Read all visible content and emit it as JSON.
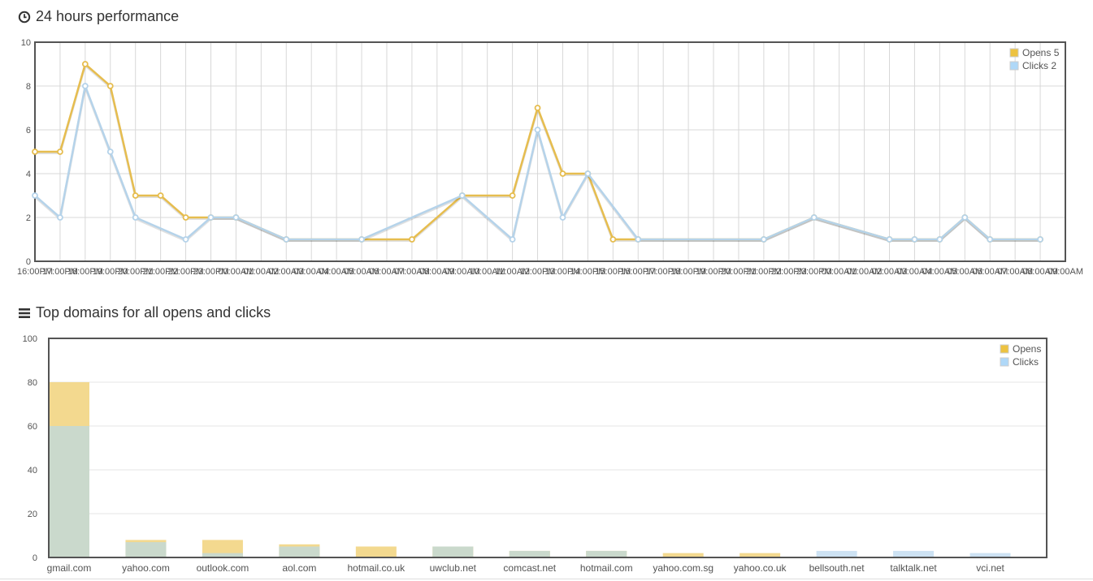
{
  "section1": {
    "title": "24 hours performance",
    "icon": "clock-icon"
  },
  "section2": {
    "title": "Top domains for all opens and clicks",
    "icon": "list-icon"
  },
  "colors": {
    "opens": "#e6bd4f",
    "opens_fill": "#f3d98f",
    "opens_legend": "#edc240",
    "clicks": "#b5d3ea",
    "clicks_fill": "#cde2f3",
    "clicks_legend": "#afd8f8",
    "overlap_fill": "#cad9cc",
    "grid": "#d8d8d8",
    "border": "#545454"
  },
  "chart_data": [
    {
      "type": "line",
      "ylim": [
        0,
        10
      ],
      "yticks": [
        0,
        2,
        4,
        6,
        8,
        10
      ],
      "grid": true,
      "legend_position": "top-right",
      "x_labels": [
        "16:00PM",
        "17:00PM",
        "18:00PM",
        "19:00PM",
        "20:00PM",
        "21:00PM",
        "22:00PM",
        "23:00PM",
        "00:00AM",
        "01:00AM",
        "02:00AM",
        "03:00AM",
        "04:00AM",
        "05:00AM",
        "06:00AM",
        "07:00AM",
        "08:00AM",
        "09:00AM",
        "10:00AM",
        "11:00AM",
        "12:00PM",
        "13:00PM",
        "14:00PM",
        "15:00PM",
        "16:00PM",
        "17:00PM",
        "18:00PM",
        "19:00PM",
        "20:00PM",
        "21:00PM",
        "22:00PM",
        "23:00PM",
        "00:00AM",
        "01:00AM",
        "02:00AM",
        "03:00AM",
        "04:00AM",
        "05:00AM",
        "06:00AM",
        "07:00AM",
        "08:00AM",
        "09:00AM"
      ],
      "series": [
        {
          "name": "Opens 5",
          "points": [
            [
              0,
              5
            ],
            [
              1,
              5
            ],
            [
              2,
              9
            ],
            [
              3,
              8
            ],
            [
              4,
              3
            ],
            [
              5,
              3
            ],
            [
              6,
              2
            ],
            [
              7,
              2
            ],
            [
              8,
              2
            ],
            [
              10,
              1
            ],
            [
              13,
              1
            ],
            [
              15,
              1
            ],
            [
              17,
              3
            ],
            [
              19,
              3
            ],
            [
              20,
              7
            ],
            [
              21,
              4
            ],
            [
              22,
              4
            ],
            [
              23,
              1
            ],
            [
              24,
              1
            ],
            [
              29,
              1
            ],
            [
              31,
              2
            ],
            [
              34,
              1
            ],
            [
              35,
              1
            ],
            [
              36,
              1
            ],
            [
              37,
              2
            ],
            [
              38,
              1
            ],
            [
              40,
              1
            ]
          ]
        },
        {
          "name": "Clicks 2",
          "points": [
            [
              0,
              3
            ],
            [
              1,
              2
            ],
            [
              2,
              8
            ],
            [
              3,
              5
            ],
            [
              4,
              2
            ],
            [
              6,
              1
            ],
            [
              7,
              2
            ],
            [
              8,
              2
            ],
            [
              10,
              1
            ],
            [
              13,
              1
            ],
            [
              17,
              3
            ],
            [
              19,
              1
            ],
            [
              20,
              6
            ],
            [
              21,
              2
            ],
            [
              22,
              4
            ],
            [
              24,
              1
            ],
            [
              29,
              1
            ],
            [
              31,
              2
            ],
            [
              34,
              1
            ],
            [
              35,
              1
            ],
            [
              36,
              1
            ],
            [
              37,
              2
            ],
            [
              38,
              1
            ],
            [
              40,
              1
            ]
          ]
        }
      ]
    },
    {
      "type": "bar",
      "ylim": [
        0,
        100
      ],
      "yticks": [
        0,
        20,
        40,
        60,
        80,
        100
      ],
      "grid": true,
      "legend_position": "top-right",
      "categories": [
        "gmail.com",
        "yahoo.com",
        "outlook.com",
        "aol.com",
        "hotmail.co.uk",
        "uwclub.net",
        "comcast.net",
        "hotmail.com",
        "yahoo.com.sg",
        "yahoo.co.uk",
        "bellsouth.net",
        "talktalk.net",
        "vci.net"
      ],
      "series": [
        {
          "name": "Opens",
          "values": [
            80,
            8,
            8,
            6,
            5,
            5,
            3,
            3,
            2,
            2,
            0,
            0,
            0
          ]
        },
        {
          "name": "Clicks",
          "values": [
            60,
            7,
            2,
            5,
            0,
            5,
            3,
            3,
            0,
            0,
            3,
            3,
            2
          ]
        }
      ]
    }
  ]
}
